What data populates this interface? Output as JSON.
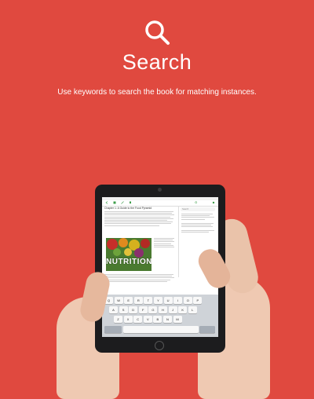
{
  "header": {
    "icon": "search-icon",
    "title": "Search",
    "subtitle": "Use keywords to search the book for matching instances."
  },
  "tablet_screen": {
    "chapter_title": "Chapter 1: A Guide to the Food Pyramid",
    "photo_word": "NUTRITION",
    "side_search_placeholder": "Search",
    "keyboard_rows": [
      [
        "Q",
        "W",
        "E",
        "R",
        "T",
        "Y",
        "U",
        "I",
        "O",
        "P"
      ],
      [
        "A",
        "S",
        "D",
        "F",
        "G",
        "H",
        "J",
        "K",
        "L"
      ],
      [
        "Z",
        "X",
        "C",
        "V",
        "B",
        "N",
        "M"
      ]
    ]
  },
  "colors": {
    "background": "#e0493f",
    "text": "#ffffff"
  }
}
